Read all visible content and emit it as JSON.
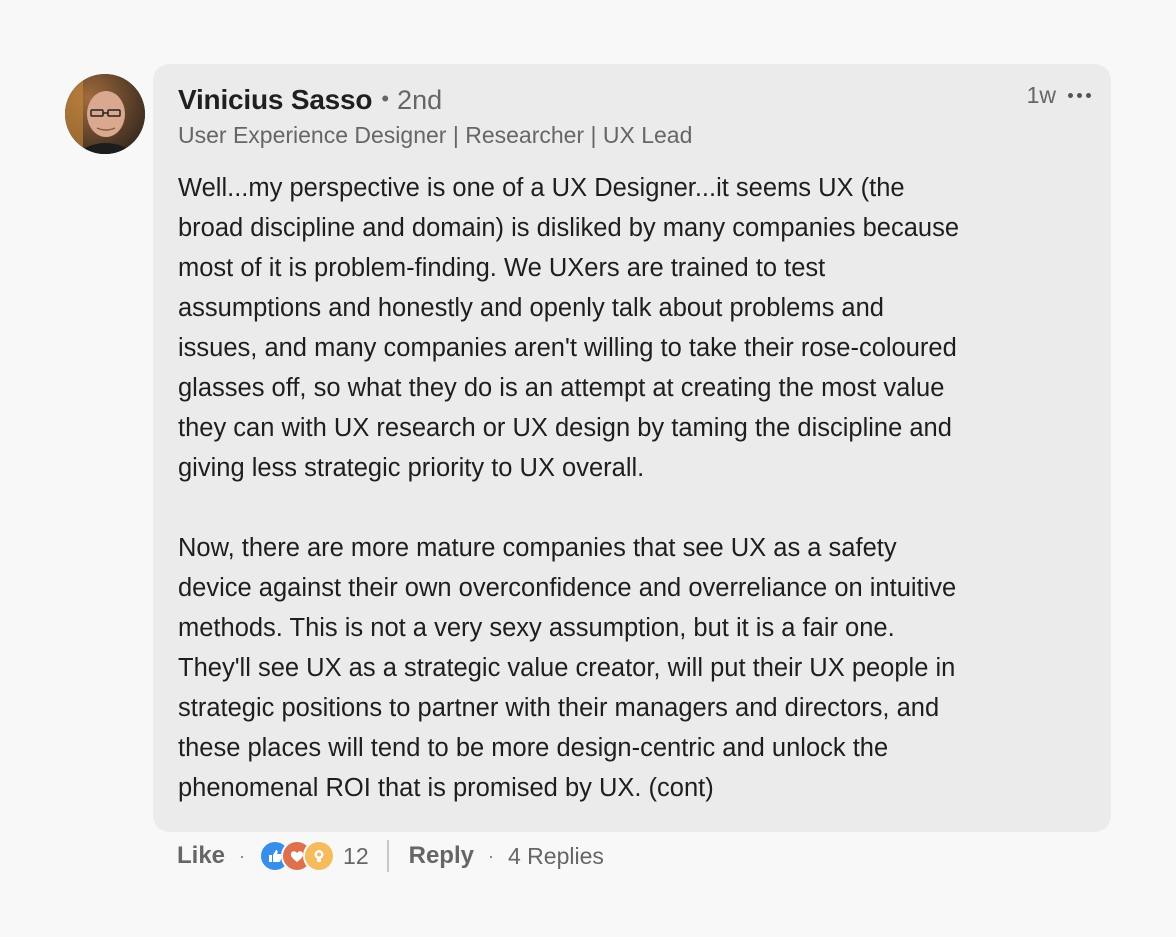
{
  "comment": {
    "author": {
      "name": "Vinicius Sasso",
      "degree": "2nd",
      "headline": "User Experience Designer | Researcher | UX Lead"
    },
    "timestamp": "1w",
    "body": [
      "Well...my perspective is one of a UX Designer...it seems UX (the",
      "broad discipline and domain) is disliked by many companies because",
      "most of it is problem-finding. We UXers are trained to test",
      "assumptions and honestly and openly talk about problems and",
      "issues, and many companies aren't willing to take their rose-coloured",
      "glasses off, so what they do is an attempt at creating the most value",
      "they can with UX research or UX design by taming the discipline and",
      "giving less strategic priority to UX overall.",
      "",
      "Now, there are more mature companies that see UX as a safety",
      "device against their own overconfidence and overreliance on intuitive",
      "methods. This is not a very sexy assumption, but it is a fair one.",
      "They'll see UX as a strategic value creator, will put their UX people in",
      "strategic positions to partner with their managers and directors, and",
      "these places will tend to be more design-centric and unlock the",
      "phenomenal ROI that is promised by UX. (cont)"
    ]
  },
  "actions": {
    "like_label": "Like",
    "reaction_icons": [
      "like-icon",
      "love-icon",
      "insightful-icon"
    ],
    "reaction_count": "12",
    "reply_label": "Reply",
    "replies_label": "4 Replies"
  },
  "colors": {
    "bubble": "#ebebeb",
    "background": "#f8f8f8",
    "like": "#378fe9",
    "love": "#df704d",
    "insightful": "#f5bb5c"
  }
}
